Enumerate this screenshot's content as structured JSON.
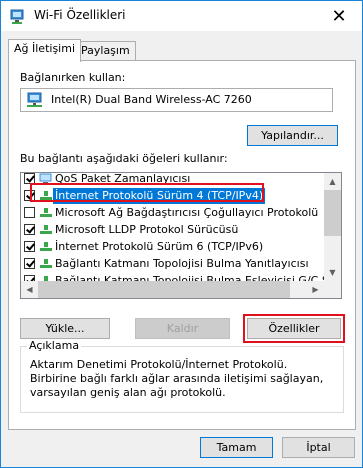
{
  "window": {
    "title": "Wi-Fi Özellikleri",
    "close_glyph": "✕"
  },
  "tabs": [
    {
      "label": "Ağ İletişimi",
      "active": true
    },
    {
      "label": "Paylaşım",
      "active": false
    }
  ],
  "connect_using": {
    "label": "Bağlanırken kullan:",
    "adapter": "Intel(R) Dual Band Wireless-AC 7260",
    "adapter_icon": "network-adapter-icon",
    "configure_label": "Yapılandır..."
  },
  "items_section": {
    "label": "Bu bağlantı aşağıdaki öğeleri kullanır:",
    "items": [
      {
        "label": "QoS Paket Zamanlayıcısı",
        "checked": true,
        "icon": "qos-icon",
        "selected": false
      },
      {
        "label": "İnternet Protokolü Sürüm 4 (TCP/IPv4)",
        "checked": true,
        "icon": "protocol-icon",
        "selected": true
      },
      {
        "label": "Microsoft Ağ Bağdaştırıcısı Çoğullayıcı Protokolü",
        "checked": false,
        "icon": "protocol-icon",
        "selected": false
      },
      {
        "label": "Microsoft LLDP Protokol Sürücüsü",
        "checked": true,
        "icon": "protocol-icon",
        "selected": false
      },
      {
        "label": "İnternet Protokolü Sürüm 6 (TCP/IPv6)",
        "checked": true,
        "icon": "protocol-icon",
        "selected": false
      },
      {
        "label": "Bağlantı Katmanı Topolojisi Bulma Yanıtlayıcısı",
        "checked": true,
        "icon": "protocol-icon",
        "selected": false
      },
      {
        "label": "Bağlantı Katmanı Topolojisi Bulma Eşleyicisi G/Ç Sürücü",
        "checked": true,
        "icon": "protocol-icon",
        "selected": false
      }
    ]
  },
  "buttons": {
    "install": "Yükle...",
    "uninstall": "Kaldır",
    "properties": "Özellikler"
  },
  "description": {
    "title": "Açıklama",
    "text": "Aktarım Denetimi Protokolü/İnternet Protokolü. Birbirine bağlı farklı ağlar arasında iletişimi sağlayan, varsayılan geniş alan ağı protokolü."
  },
  "footer": {
    "ok": "Tamam",
    "cancel": "İptal"
  },
  "colors": {
    "selection": "#0078d7",
    "highlight_box": "#e0101c",
    "window_border": "#1883d7"
  }
}
